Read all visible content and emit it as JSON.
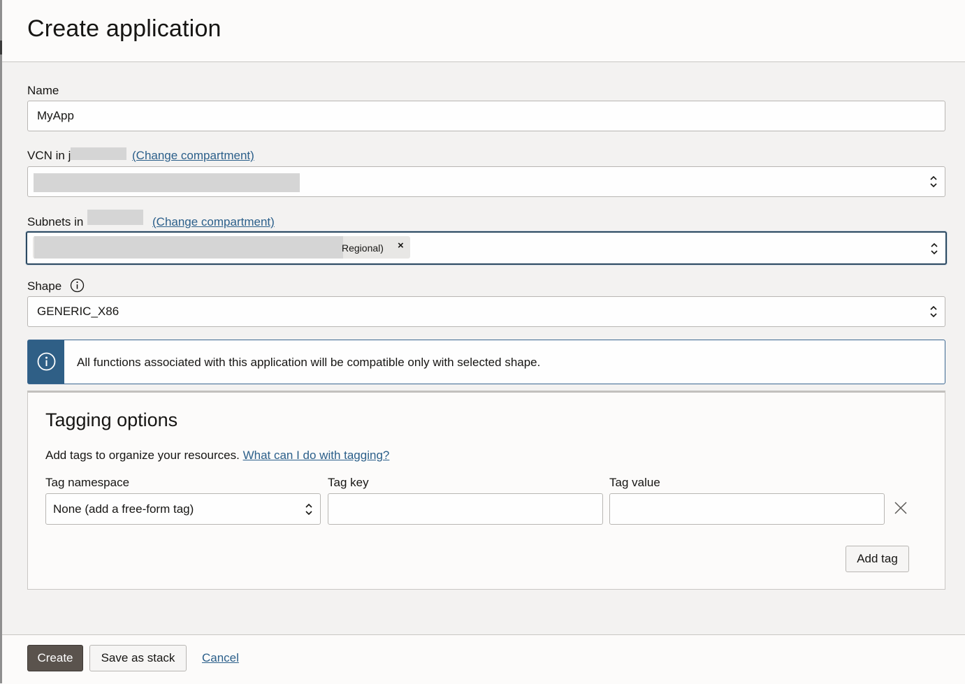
{
  "dialog": {
    "title": "Create application"
  },
  "form": {
    "name_label": "Name",
    "name_value": "MyApp",
    "vcn_label": "VCN in",
    "vcn_compartment_prefix": "j",
    "vcn_change_link": "(Change compartment)",
    "subnets_label": "Subnets in",
    "subnets_change_link": "(Change compartment)",
    "subnet_chip_text": "Regional)",
    "subnet_chip_remove": "×",
    "shape_label": "Shape",
    "shape_value": "GENERIC_X86"
  },
  "info_message": "All functions associated with this application will be compatible only with selected shape.",
  "tagging": {
    "title": "Tagging options",
    "description": "Add tags to organize your resources.",
    "help_link": "What can I do with tagging?",
    "namespace_label": "Tag namespace",
    "namespace_value": "None (add a free-form tag)",
    "key_label": "Tag key",
    "key_value": "",
    "value_label": "Tag value",
    "value_value": "",
    "add_tag_button": "Add tag"
  },
  "footer": {
    "create_button": "Create",
    "save_stack_button": "Save as stack",
    "cancel_link": "Cancel"
  },
  "colors": {
    "primary_button": "#5a534d",
    "link": "#2b5f8a",
    "info_bar": "#2f5f86"
  }
}
